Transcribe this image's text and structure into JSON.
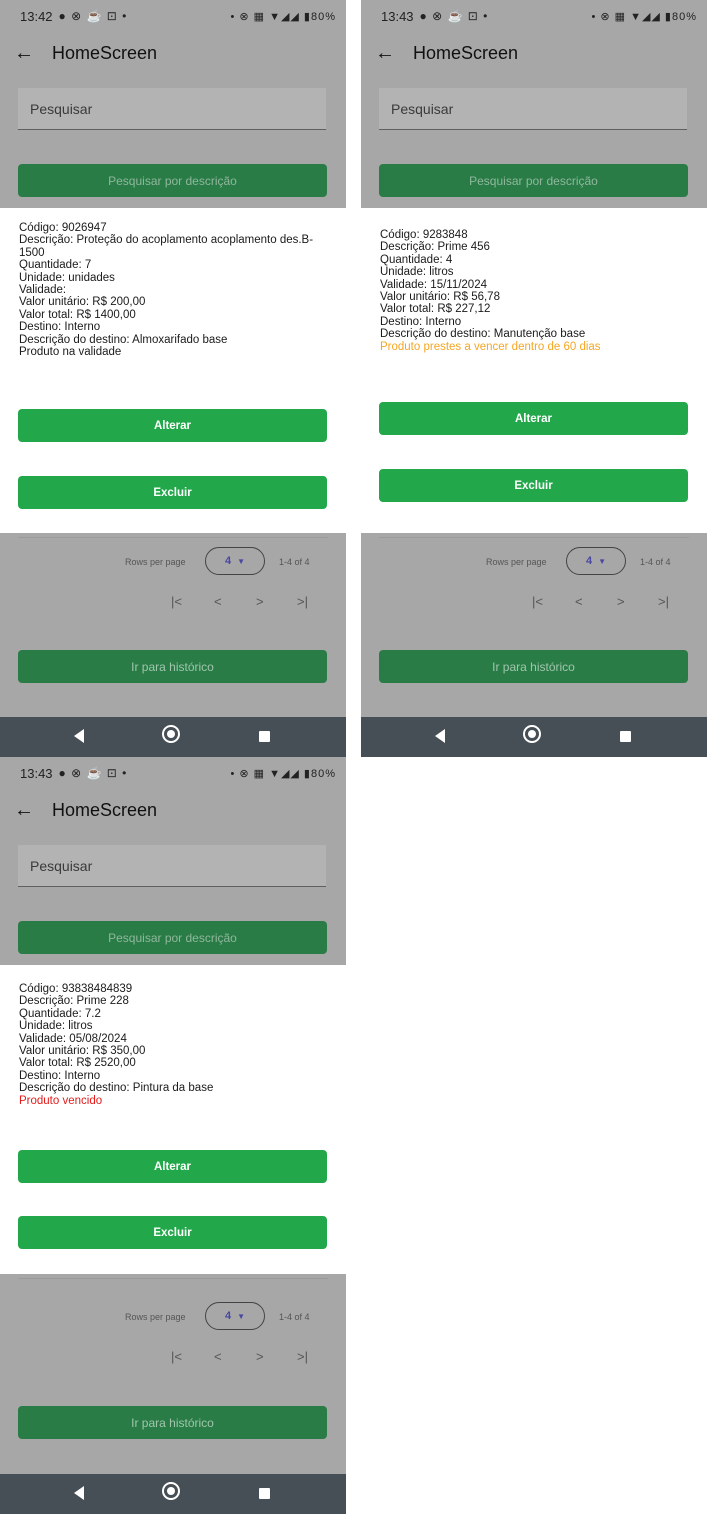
{
  "screens": [
    {
      "status": {
        "time": "13:42",
        "left_icons": "● ⊗ ☕ ⊡ •",
        "right_icons": "• ⊗ ▦ ▼◢◢ ▮80%"
      },
      "app_bar": {
        "title": "HomeScreen"
      },
      "search": {
        "placeholder": "Pesquisar",
        "button_label": "Pesquisar por descrição"
      },
      "product": {
        "lines": [
          "Código: 9026947",
          "Descrição: Proteção do acoplamento acoplamento des.B-1500",
          "Quantidade: 7",
          "Unidade: unidades",
          "Validade:",
          "Valor unitário: R$ 200,00",
          "Valor total: R$ 1400,00",
          "Destino: Interno",
          "Descrição do destino: Almoxarifado base"
        ],
        "status": "Produto na validade"
      },
      "actions": {
        "alter_label": "Alterar",
        "delete_label": "Excluir"
      },
      "pagination": {
        "rows_label": "Rows per page",
        "rows_value": "4",
        "range": "1-4 of 4",
        "first": "|<",
        "prev": "<",
        "next": ">",
        "last": ">|"
      },
      "history_label": "Ir para histórico"
    },
    {
      "status": {
        "time": "13:43",
        "left_icons": "● ⊗ ☕ ⊡ •",
        "right_icons": "• ⊗ ▦ ▼◢◢ ▮80%"
      },
      "app_bar": {
        "title": "HomeScreen"
      },
      "search": {
        "placeholder": "Pesquisar",
        "button_label": "Pesquisar por descrição"
      },
      "product": {
        "lines": [
          "Código: 9283848",
          "Descrição: Prime 456",
          "Quantidade: 4",
          "Unidade: litros",
          "Validade: 15/11/2024",
          "Valor unitário: R$ 56,78",
          "Valor total: R$ 227,12",
          "Destino: Interno",
          "Descrição do destino: Manutenção base"
        ],
        "status": "Produto prestes a vencer dentro de 60 dias"
      },
      "actions": {
        "alter_label": "Alterar",
        "delete_label": "Excluir"
      },
      "pagination": {
        "rows_label": "Rows per page",
        "rows_value": "4",
        "range": "1-4 of 4",
        "first": "|<",
        "prev": "<",
        "next": ">",
        "last": ">|"
      },
      "history_label": "Ir para histórico"
    },
    {
      "status": {
        "time": "13:43",
        "left_icons": "● ⊗ ☕ ⊡ •",
        "right_icons": "• ⊗ ▦ ▼◢◢ ▮80%"
      },
      "app_bar": {
        "title": "HomeScreen"
      },
      "search": {
        "placeholder": "Pesquisar",
        "button_label": "Pesquisar por descrição"
      },
      "product": {
        "lines": [
          "Código: 93838484839",
          "Descrição: Prime 228",
          "Quantidade: 7.2",
          "Unidade: litros",
          "Validade: 05/08/2024",
          "Valor unitário: R$ 350,00",
          "Valor total: R$ 2520,00",
          "Destino: Interno",
          "Descrição do destino: Pintura da base"
        ],
        "status": "Produto vencido"
      },
      "actions": {
        "alter_label": "Alterar",
        "delete_label": "Excluir"
      },
      "pagination": {
        "rows_label": "Rows per page",
        "rows_value": "4",
        "range": "1-4 of 4",
        "first": "|<",
        "prev": "<",
        "next": ">",
        "last": ">|"
      },
      "history_label": "Ir para histórico"
    }
  ],
  "colors": {
    "overlay_gray": "#a7a7a7",
    "primary_green": "#22a84a",
    "dimmed_green": "#2a7c47",
    "warning_orange": "#f5a623",
    "expired_red": "#e31b1b",
    "nav_bar": "#474f56"
  },
  "icons": {
    "back": "arrow-left-icon",
    "dropdown": "caret-down-icon",
    "nav_back": "triangle-back-icon",
    "nav_home": "circle-home-icon",
    "nav_recent": "square-recent-icon"
  }
}
